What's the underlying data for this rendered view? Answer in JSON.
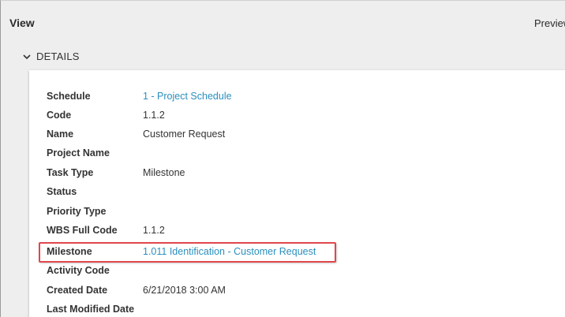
{
  "header": {
    "title": "View",
    "preview_label": "Preview"
  },
  "section": {
    "label": "DETAILS",
    "chevron_icon": "chevron-down-icon",
    "expanded": true
  },
  "details": [
    {
      "label": "Schedule",
      "value": "1 - Project Schedule",
      "is_link": true
    },
    {
      "label": "Code",
      "value": "1.1.2",
      "is_link": false
    },
    {
      "label": "Name",
      "value": "Customer Request",
      "is_link": false
    },
    {
      "label": "Project Name",
      "value": "",
      "is_link": false
    },
    {
      "label": "Task Type",
      "value": "Milestone",
      "is_link": false
    },
    {
      "label": "Status",
      "value": "",
      "is_link": false
    },
    {
      "label": "Priority Type",
      "value": "",
      "is_link": false
    },
    {
      "label": "WBS Full Code",
      "value": "1.1.2",
      "is_link": false
    },
    {
      "label": "Milestone",
      "value": "1.011 Identification - Customer Request",
      "is_link": true
    },
    {
      "label": "Activity Code",
      "value": "",
      "is_link": false
    },
    {
      "label": "Created Date",
      "value": "6/21/2018 3:00 AM",
      "is_link": false
    },
    {
      "label": "Last Modified Date",
      "value": "",
      "is_link": false
    }
  ],
  "colors": {
    "link": "#2a8fbd",
    "highlight": "#e0474c",
    "panel_bg": "#eeeeee"
  }
}
